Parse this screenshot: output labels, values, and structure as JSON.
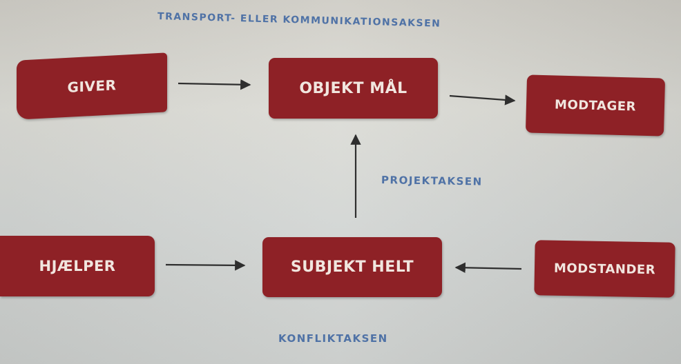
{
  "axes": {
    "transport": "TRANSPORT- ELLER KOMMUNIKATIONSAKSEN",
    "project": "PROJEKTAKSEN",
    "conflict": "KONFLIKTAKSEN"
  },
  "boxes": {
    "giver": "GIVER",
    "object": "OBJEKT MÅL",
    "receiver": "MODTAGER",
    "helper": "HJÆLPER",
    "subject": "SUBJEKT HELT",
    "opponent": "MODSTANDER"
  },
  "colors": {
    "box_fill": "#8e2126",
    "box_text": "#f1e6df",
    "axis_text": "#4f72a6",
    "arrow": "#2e2e2e"
  },
  "edges": [
    {
      "from": "giver",
      "to": "object"
    },
    {
      "from": "object",
      "to": "receiver"
    },
    {
      "from": "subject",
      "to": "object"
    },
    {
      "from": "helper",
      "to": "subject"
    },
    {
      "from": "opponent",
      "to": "subject"
    }
  ]
}
